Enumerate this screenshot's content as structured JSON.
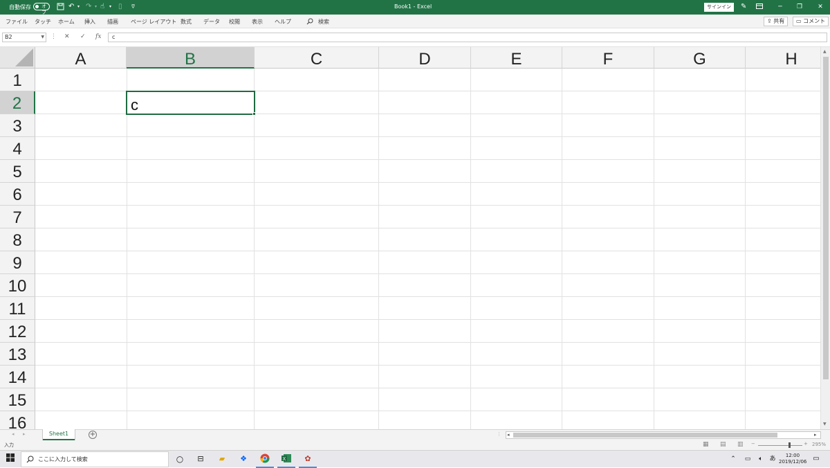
{
  "titlebar": {
    "autosave_label": "自動保存",
    "autosave_state": "オフ",
    "title": "Book1  -  Excel",
    "signin_label": "サインイン",
    "customize_qat": "⩢"
  },
  "ribbon": {
    "tabs": [
      "ファイル",
      "タッチ",
      "ホーム",
      "挿入",
      "描画",
      "ページ レイアウト",
      "数式",
      "データ",
      "校閲",
      "表示",
      "ヘルプ"
    ],
    "search_label": "検索",
    "share_label": "共有",
    "comment_label": "コメント"
  },
  "formula_bar": {
    "name_box": "B2",
    "formula": "c"
  },
  "grid": {
    "columns": [
      "A",
      "B",
      "C",
      "D",
      "E",
      "F",
      "G",
      "H"
    ],
    "rows": [
      "1",
      "2",
      "3",
      "4",
      "5",
      "6",
      "7",
      "8",
      "9",
      "10",
      "11",
      "12",
      "13",
      "14",
      "15",
      "16"
    ],
    "selected_column": "B",
    "selected_row": "2",
    "active_cell_value": "c"
  },
  "sheets": {
    "tabs": [
      "Sheet1"
    ],
    "add_label": "+"
  },
  "status": {
    "mode": "入力",
    "zoom": "295%"
  },
  "taskbar": {
    "search_placeholder": "ここに入力して検索",
    "time": "12:00",
    "date": "2019/12/06",
    "ime": "あ"
  },
  "colors": {
    "excel_green": "#217346",
    "selection_green": "#1e6b41"
  }
}
